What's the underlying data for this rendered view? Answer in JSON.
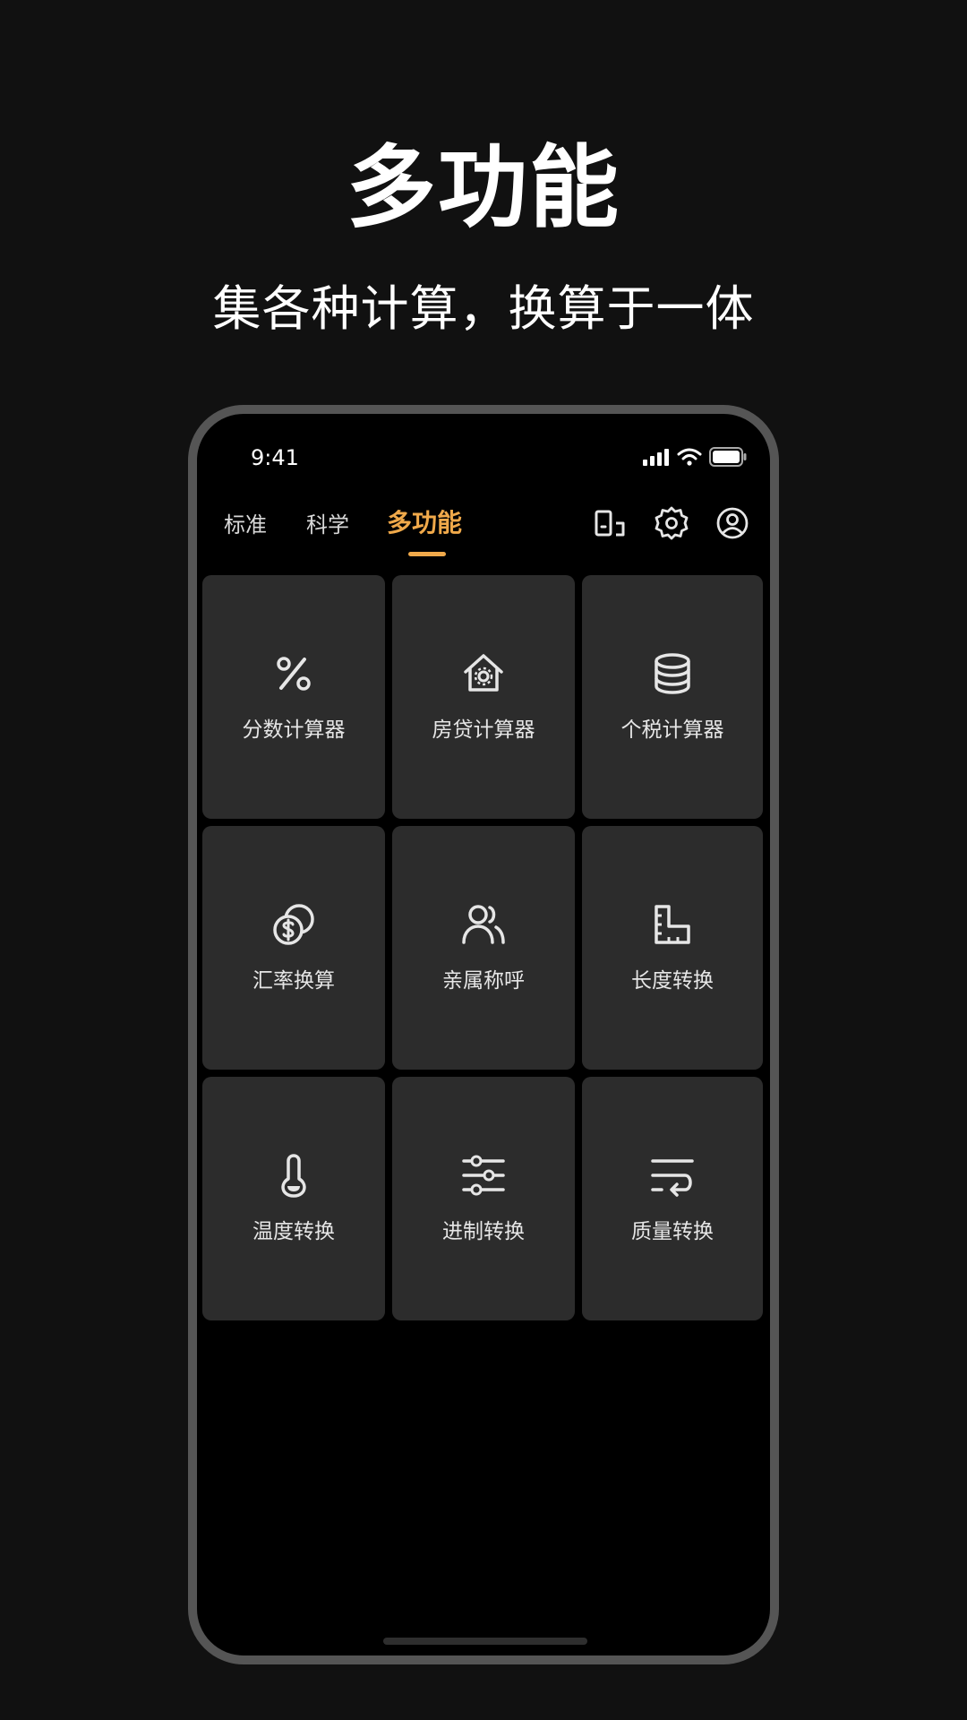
{
  "headline": "多功能",
  "subheadline": "集各种计算，换算于一体",
  "status_bar": {
    "time": "9:41"
  },
  "tabs": [
    {
      "label": "标准",
      "active": false
    },
    {
      "label": "科学",
      "active": false
    },
    {
      "label": "多功能",
      "active": true
    }
  ],
  "toolbar_icons": [
    "layout-toggle-icon",
    "gear-icon",
    "user-circle-icon"
  ],
  "tools": [
    {
      "label": "分数计算器",
      "icon": "percent-icon"
    },
    {
      "label": "房贷计算器",
      "icon": "house-gear-icon"
    },
    {
      "label": "个税计算器",
      "icon": "database-icon"
    },
    {
      "label": "汇率换算",
      "icon": "coins-dollar-icon"
    },
    {
      "label": "亲属称呼",
      "icon": "users-icon"
    },
    {
      "label": "长度转换",
      "icon": "ruler-icon"
    },
    {
      "label": "温度转换",
      "icon": "thermometer-icon"
    },
    {
      "label": "进制转换",
      "icon": "sliders-icon"
    },
    {
      "label": "质量转换",
      "icon": "text-wrap-icon"
    }
  ],
  "colors": {
    "background": "#111111",
    "phone_frame": "#555555",
    "card": "#2c2c2c",
    "accent": "#f0a94a"
  }
}
